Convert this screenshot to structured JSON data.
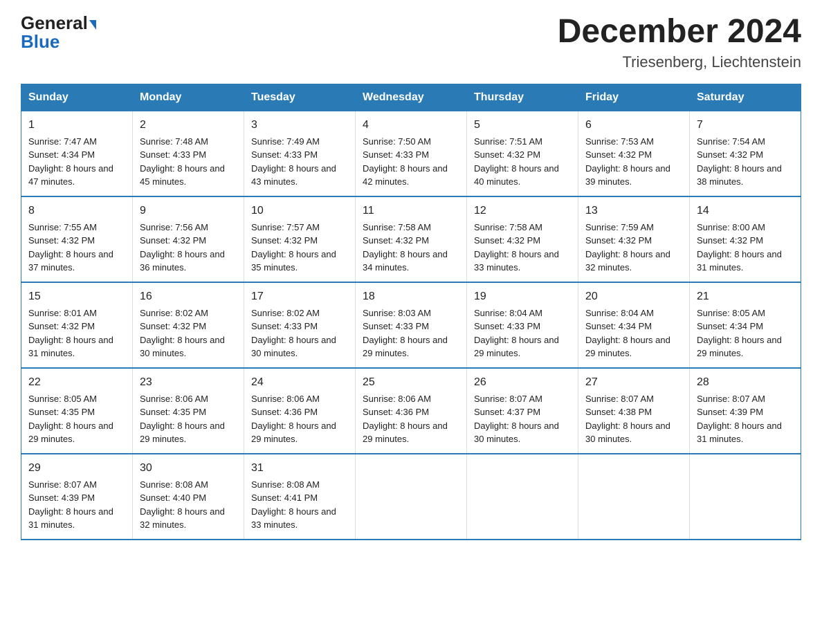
{
  "header": {
    "logo_general": "General",
    "logo_blue": "Blue",
    "title": "December 2024",
    "location": "Triesenberg, Liechtenstein"
  },
  "days_of_week": [
    "Sunday",
    "Monday",
    "Tuesday",
    "Wednesday",
    "Thursday",
    "Friday",
    "Saturday"
  ],
  "weeks": [
    [
      {
        "day": "1",
        "sunrise": "7:47 AM",
        "sunset": "4:34 PM",
        "daylight": "8 hours and 47 minutes."
      },
      {
        "day": "2",
        "sunrise": "7:48 AM",
        "sunset": "4:33 PM",
        "daylight": "8 hours and 45 minutes."
      },
      {
        "day": "3",
        "sunrise": "7:49 AM",
        "sunset": "4:33 PM",
        "daylight": "8 hours and 43 minutes."
      },
      {
        "day": "4",
        "sunrise": "7:50 AM",
        "sunset": "4:33 PM",
        "daylight": "8 hours and 42 minutes."
      },
      {
        "day": "5",
        "sunrise": "7:51 AM",
        "sunset": "4:32 PM",
        "daylight": "8 hours and 40 minutes."
      },
      {
        "day": "6",
        "sunrise": "7:53 AM",
        "sunset": "4:32 PM",
        "daylight": "8 hours and 39 minutes."
      },
      {
        "day": "7",
        "sunrise": "7:54 AM",
        "sunset": "4:32 PM",
        "daylight": "8 hours and 38 minutes."
      }
    ],
    [
      {
        "day": "8",
        "sunrise": "7:55 AM",
        "sunset": "4:32 PM",
        "daylight": "8 hours and 37 minutes."
      },
      {
        "day": "9",
        "sunrise": "7:56 AM",
        "sunset": "4:32 PM",
        "daylight": "8 hours and 36 minutes."
      },
      {
        "day": "10",
        "sunrise": "7:57 AM",
        "sunset": "4:32 PM",
        "daylight": "8 hours and 35 minutes."
      },
      {
        "day": "11",
        "sunrise": "7:58 AM",
        "sunset": "4:32 PM",
        "daylight": "8 hours and 34 minutes."
      },
      {
        "day": "12",
        "sunrise": "7:58 AM",
        "sunset": "4:32 PM",
        "daylight": "8 hours and 33 minutes."
      },
      {
        "day": "13",
        "sunrise": "7:59 AM",
        "sunset": "4:32 PM",
        "daylight": "8 hours and 32 minutes."
      },
      {
        "day": "14",
        "sunrise": "8:00 AM",
        "sunset": "4:32 PM",
        "daylight": "8 hours and 31 minutes."
      }
    ],
    [
      {
        "day": "15",
        "sunrise": "8:01 AM",
        "sunset": "4:32 PM",
        "daylight": "8 hours and 31 minutes."
      },
      {
        "day": "16",
        "sunrise": "8:02 AM",
        "sunset": "4:32 PM",
        "daylight": "8 hours and 30 minutes."
      },
      {
        "day": "17",
        "sunrise": "8:02 AM",
        "sunset": "4:33 PM",
        "daylight": "8 hours and 30 minutes."
      },
      {
        "day": "18",
        "sunrise": "8:03 AM",
        "sunset": "4:33 PM",
        "daylight": "8 hours and 29 minutes."
      },
      {
        "day": "19",
        "sunrise": "8:04 AM",
        "sunset": "4:33 PM",
        "daylight": "8 hours and 29 minutes."
      },
      {
        "day": "20",
        "sunrise": "8:04 AM",
        "sunset": "4:34 PM",
        "daylight": "8 hours and 29 minutes."
      },
      {
        "day": "21",
        "sunrise": "8:05 AM",
        "sunset": "4:34 PM",
        "daylight": "8 hours and 29 minutes."
      }
    ],
    [
      {
        "day": "22",
        "sunrise": "8:05 AM",
        "sunset": "4:35 PM",
        "daylight": "8 hours and 29 minutes."
      },
      {
        "day": "23",
        "sunrise": "8:06 AM",
        "sunset": "4:35 PM",
        "daylight": "8 hours and 29 minutes."
      },
      {
        "day": "24",
        "sunrise": "8:06 AM",
        "sunset": "4:36 PM",
        "daylight": "8 hours and 29 minutes."
      },
      {
        "day": "25",
        "sunrise": "8:06 AM",
        "sunset": "4:36 PM",
        "daylight": "8 hours and 29 minutes."
      },
      {
        "day": "26",
        "sunrise": "8:07 AM",
        "sunset": "4:37 PM",
        "daylight": "8 hours and 30 minutes."
      },
      {
        "day": "27",
        "sunrise": "8:07 AM",
        "sunset": "4:38 PM",
        "daylight": "8 hours and 30 minutes."
      },
      {
        "day": "28",
        "sunrise": "8:07 AM",
        "sunset": "4:39 PM",
        "daylight": "8 hours and 31 minutes."
      }
    ],
    [
      {
        "day": "29",
        "sunrise": "8:07 AM",
        "sunset": "4:39 PM",
        "daylight": "8 hours and 31 minutes."
      },
      {
        "day": "30",
        "sunrise": "8:08 AM",
        "sunset": "4:40 PM",
        "daylight": "8 hours and 32 minutes."
      },
      {
        "day": "31",
        "sunrise": "8:08 AM",
        "sunset": "4:41 PM",
        "daylight": "8 hours and 33 minutes."
      },
      null,
      null,
      null,
      null
    ]
  ],
  "labels": {
    "sunrise": "Sunrise: ",
    "sunset": "Sunset: ",
    "daylight": "Daylight: "
  }
}
